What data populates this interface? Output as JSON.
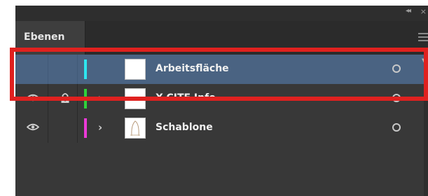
{
  "panel": {
    "tab_label": "Ebenen",
    "header_icons": [
      "collapse-arrows-icon",
      "close-icon",
      "panel-menu-icon"
    ],
    "collapse_glyph": "◂◂",
    "close_glyph": "×"
  },
  "layers": [
    {
      "name": "Arbeitsfläche",
      "visible": false,
      "locked": false,
      "color": "#2ee6f0",
      "expandable": false,
      "selected": true
    },
    {
      "name": "X-CITE Info",
      "visible": true,
      "locked": true,
      "color": "#2fd23a",
      "expandable": true,
      "selected": false
    },
    {
      "name": "Schablone",
      "visible": true,
      "locked": false,
      "color": "#ec3ad8",
      "expandable": true,
      "selected": false
    }
  ],
  "glyphs": {
    "expand": "›"
  },
  "colors": {
    "selection": "#4a6382",
    "highlight_box": "#e0211f",
    "panel_bg": "#383838"
  }
}
